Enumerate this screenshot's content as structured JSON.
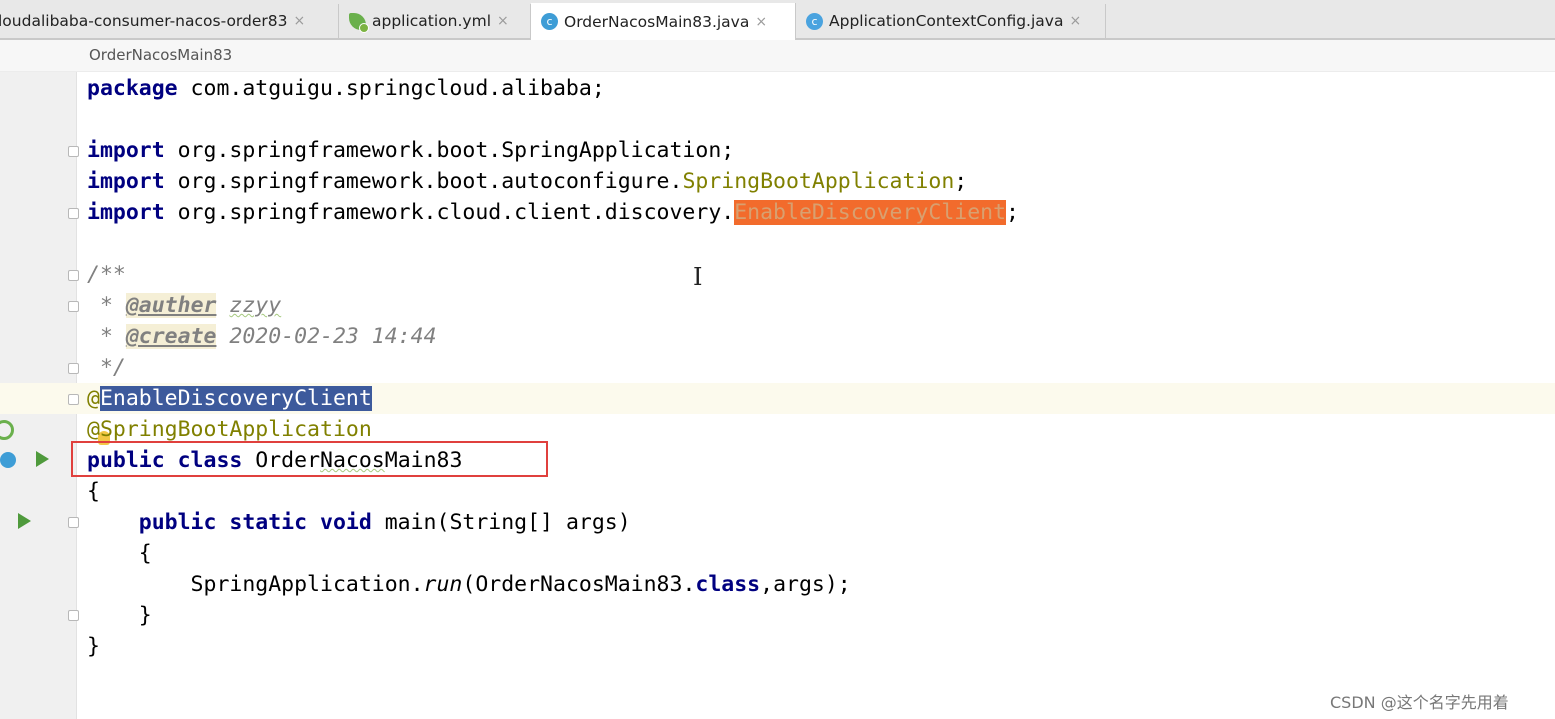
{
  "tabs": [
    {
      "label": "loudalibaba-consumer-nacos-order83",
      "icon": "folder-icon"
    },
    {
      "label": "application.yml",
      "icon": "spring-yml-icon"
    },
    {
      "label": "OrderNacosMain83.java",
      "icon": "spring-class-icon"
    },
    {
      "label": "ApplicationContextConfig.java",
      "icon": "class-icon"
    }
  ],
  "tab_close": "×",
  "active_tab_index": 2,
  "breadcrumb": "OrderNacosMain83",
  "class_icon_letter": "c",
  "code": {
    "l1_kw": "package",
    "l1_rest": " com.atguigu.springcloud.alibaba;",
    "l3_kw": "import",
    "l3_rest": " org.springframework.boot.SpringApplication;",
    "l4_kw": "import",
    "l4_rest": " org.springframework.boot.autoconfigure.",
    "l4_ann": "SpringBootApplication",
    "l4_end": ";",
    "l5_kw": "import",
    "l5_rest": " org.springframework.cloud.client.discovery.",
    "l5_warn": "EnableDiscoveryClient",
    "l5_end": ";",
    "l7": "/**",
    "l8_star": " * ",
    "l8_tag": "@auther",
    "l8_val": "zzyy",
    "l9_star": " * ",
    "l9_tag": "@create",
    "l9_val": "2020-02-23 14:44",
    "l10": " */",
    "l11_at": "@",
    "l11_sel": "EnableDiscoveryClient",
    "l12": "@SpringBootApplication",
    "l13_kw": "public class",
    "l13_pre": " Order",
    "l13_sq": "Nacos",
    "l13_post": "Main83",
    "l14": "{",
    "l15_kw": "    public static void",
    "l15_rest": " main(String[] args)",
    "l16": "    {",
    "l17_a": "        SpringApplication.",
    "l17_run": "run",
    "l17_b": "(OrderNacosMain83.",
    "l17_kw": "class",
    "l17_c": ",args);",
    "l18": "    }",
    "l19": "}"
  },
  "watermark": "CSDN @这个名字先用着"
}
